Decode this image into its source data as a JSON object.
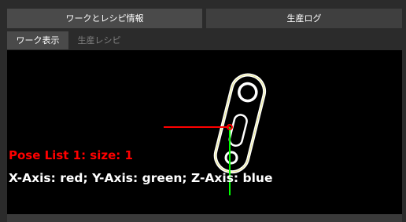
{
  "top_tabs": {
    "work_recipe_info": "ワークとレシピ情報",
    "production_log": "生産ログ"
  },
  "sub_tabs": {
    "work_display": "ワーク表示",
    "production_recipe": "生産レシピ"
  },
  "viewport": {
    "pose_list_text": "Pose List 1: size: 1",
    "axis_legend_text": "X-Axis: red; Y-Axis: green; Z-Axis: blue"
  },
  "colors": {
    "x_axis": "#ff0000",
    "y_axis": "#00ff00",
    "z_axis": "#0000ff",
    "pose_text": "#ff0000",
    "legend_text": "#ffffff"
  }
}
